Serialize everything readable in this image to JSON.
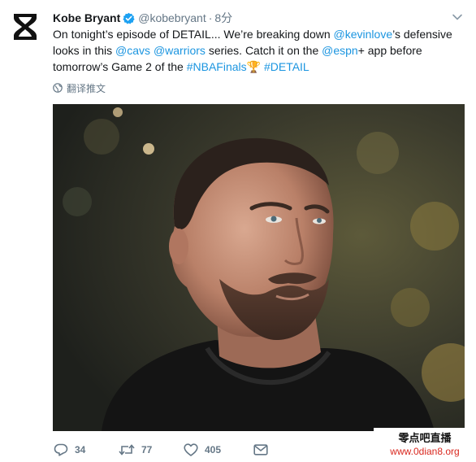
{
  "tweet": {
    "author_name": "Kobe Bryant",
    "handle": "@kobebryant",
    "separator": "·",
    "time": "8分",
    "text_segments": [
      {
        "t": "On tonight’s episode of DETAIL... We’re breaking down ",
        "c": "plain"
      },
      {
        "t": "@kevinlove",
        "c": "mention"
      },
      {
        "t": "’s defensive looks in this ",
        "c": "plain"
      },
      {
        "t": "@cavs",
        "c": "mention"
      },
      {
        "t": " ",
        "c": "plain"
      },
      {
        "t": "@warriors",
        "c": "mention"
      },
      {
        "t": " series.  Catch it on the ",
        "c": "plain"
      },
      {
        "t": "@espn",
        "c": "mention"
      },
      {
        "t": "+ app before tomorrow’s Game 2 of the ",
        "c": "plain"
      },
      {
        "t": "#NBAFinals",
        "c": "hashtag"
      },
      {
        "t": "🏆",
        "c": "emoji"
      },
      {
        "t": " ",
        "c": "plain"
      },
      {
        "t": "#DETAIL",
        "c": "hashtag"
      }
    ],
    "translate_label": "翻译推文",
    "reply_count": "34",
    "retweet_count": "77",
    "like_count": "405"
  },
  "watermark": {
    "title": "零点吧直播",
    "url": "www.0dian8.org"
  },
  "colors": {
    "link": "#1b95e0",
    "verified": "#1da1f2",
    "muted": "#657786",
    "watermark_url": "#d9271e"
  },
  "icons": [
    "hourglass-logo-icon",
    "verified-badge-icon",
    "chevron-down-icon",
    "globe-icon",
    "reply-icon",
    "retweet-icon",
    "like-icon",
    "message-icon"
  ]
}
